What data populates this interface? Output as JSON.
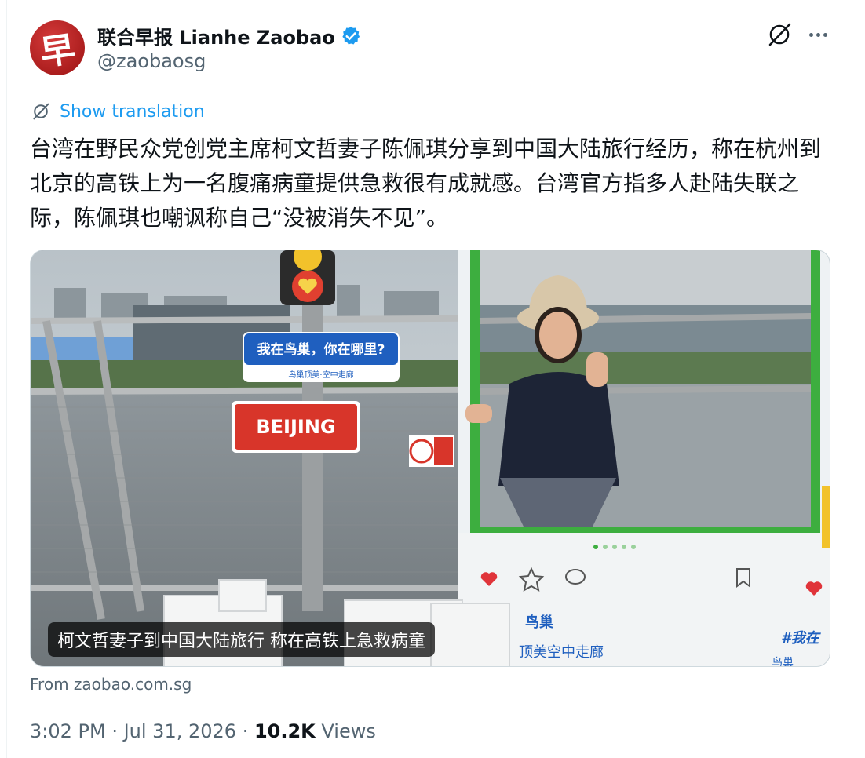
{
  "account": {
    "display_name": "联合早报 Lianhe Zaobao",
    "handle": "@zaobaosg",
    "avatar_glyph": "早",
    "verified_color": "#1d9bf0"
  },
  "header_actions": {
    "grok_icon": "grok-icon",
    "more_icon": "more-icon"
  },
  "translation": {
    "label": "Show translation"
  },
  "tweet": {
    "text": "台湾在野民众党创党主席柯文哲妻子陈佩琪分享到中国大陆旅行经历，称在杭州到北京的高铁上为一名腹痛病童提供急救很有成就感。台湾官方指多人赴陆失联之际，陈佩琪也嘲讽称自己“没被消失不见”。"
  },
  "media": {
    "caption": "柯文哲妻子到中国大陆旅行 称在高铁上急救病童",
    "sign_beijing": "BEIJING",
    "sign_question": "我在鸟巢，你在哪里?",
    "sign_sub": "鸟巢顶美·空中走廊",
    "banner_title": "鸟巢",
    "banner_sub": "顶美空中走廊",
    "hashtag": "#我在",
    "corner_text": "鸟巢"
  },
  "card": {
    "source": "From zaobao.com.sg"
  },
  "meta": {
    "time": "3:02 PM",
    "sep1": " · ",
    "date": "Jul 31, 2026",
    "sep2": " · ",
    "views_count": "10.2K",
    "views_label": " Views"
  }
}
